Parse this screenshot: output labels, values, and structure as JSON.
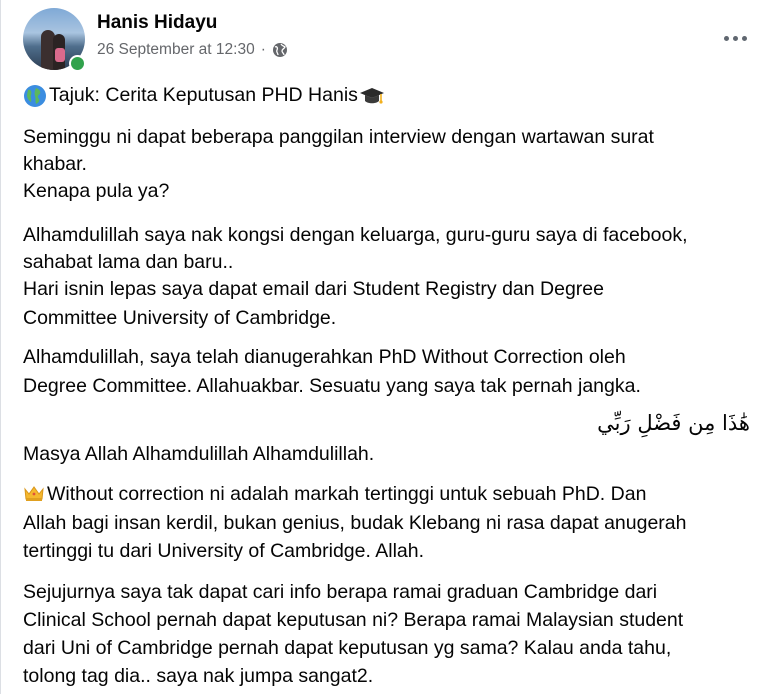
{
  "post": {
    "author_name": "Hanis Hidayu",
    "timestamp": "26 September at 12:30",
    "separator": "·",
    "privacy_icon": "globe-icon",
    "online": true
  },
  "content": {
    "title": "Tajuk: Cerita Keputusan PHD Hanis",
    "p1_l1": "Seminggu ni dapat beberapa panggilan interview dengan wartawan surat",
    "p1_l2": "khabar.",
    "p1_l3": "Kenapa pula ya?",
    "p2_l1": "Alhamdulillah saya nak kongsi dengan keluarga, guru-guru saya di facebook,",
    "p2_l2": "sahabat lama dan baru..",
    "p2_l3": "Hari isnin lepas saya dapat email dari Student Registry dan Degree",
    "p2_l4": "Committee University of Cambridge.",
    "p3_l1": "Alhamdulillah, saya telah dianugerahkan PhD Without Correction oleh",
    "p3_l2": "Degree Committee. Allahuakbar. Sesuatu yang saya tak pernah jangka.",
    "arabic": "هَٰذَا مِن فَضْلِ رَبِّي",
    "p4_l1": "Masya Allah Alhamdulillah Alhamdulillah.",
    "p5_l1": "Without correction ni adalah markah tertinggi untuk sebuah PhD. Dan",
    "p5_l2": "Allah bagi insan kerdil, bukan genius, budak Klebang ni rasa dapat anugerah",
    "p5_l3": "tertinggi tu dari University of Cambridge. Allah.",
    "p6_l1": "Sejujurnya saya tak dapat cari info berapa ramai graduan Cambridge dari",
    "p6_l2": "Clinical School pernah dapat keputusan ni? Berapa ramai Malaysian student",
    "p6_l3": "dari Uni of Cambridge pernah dapat keputusan yg sama? Kalau anda tahu,",
    "p6_l4": "tolong tag dia.. saya nak jumpa sangat2."
  },
  "colors": {
    "text": "#050505",
    "meta": "#65676b",
    "online": "#31a24c"
  }
}
